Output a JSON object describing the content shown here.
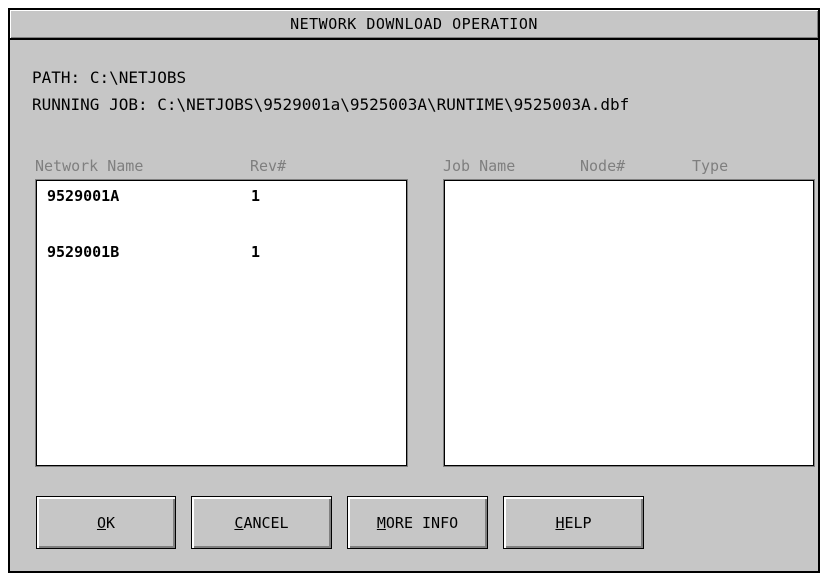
{
  "window": {
    "title": "NETWORK DOWNLOAD OPERATION"
  },
  "info": {
    "path_label": "PATH:",
    "path_value": "C:\\NETJOBS",
    "running_label": "RUNNING JOB:",
    "running_value": "C:\\NETJOBS\\9529001a\\9525003A\\RUNTIME\\9525003A.dbf"
  },
  "networks": {
    "columns": [
      "Network Name",
      "Rev#"
    ],
    "rows": [
      {
        "name": "9529001A",
        "rev": "1"
      },
      {
        "name": "9529001B",
        "rev": "1"
      }
    ]
  },
  "jobs": {
    "columns": [
      "Job Name",
      "Node#",
      "Type"
    ],
    "rows": []
  },
  "buttons": {
    "ok": {
      "mnemonic": "O",
      "rest": "K"
    },
    "cancel": {
      "mnemonic": "C",
      "rest": "ANCEL"
    },
    "more_info": {
      "mnemonic": "M",
      "rest": "ORE INFO"
    },
    "help": {
      "mnemonic": "H",
      "rest": "ELP"
    }
  }
}
